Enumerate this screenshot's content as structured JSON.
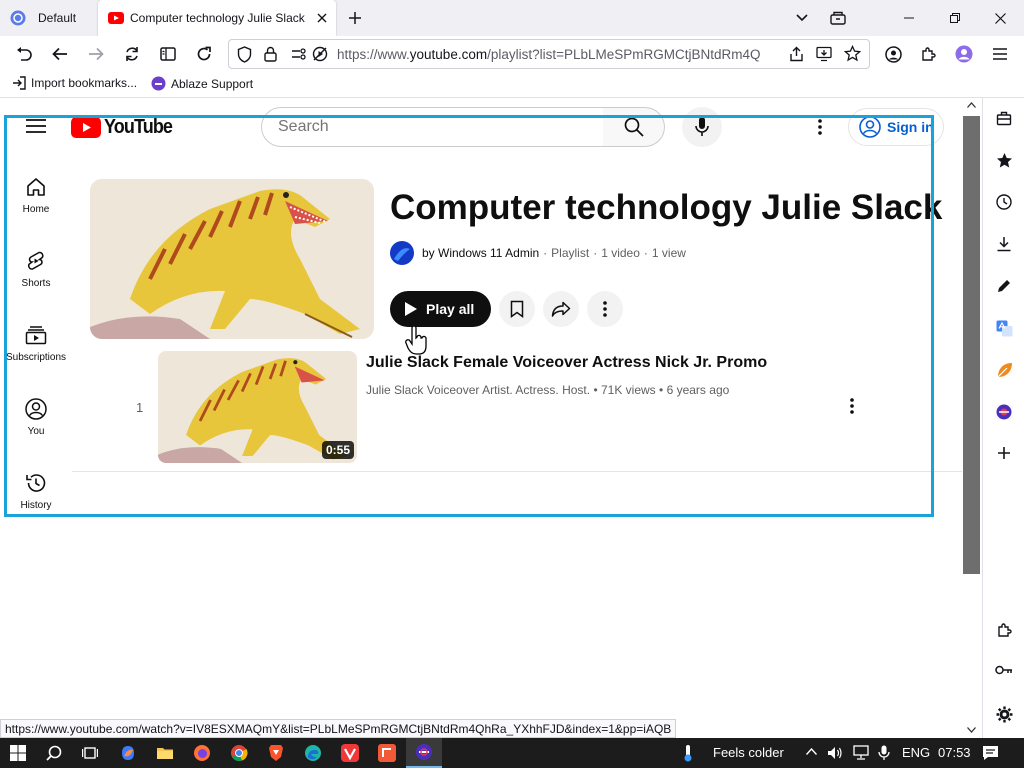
{
  "browser": {
    "tabs": [
      {
        "label": "Default",
        "active": false
      },
      {
        "label": "Computer technology Julie Slack",
        "active": true
      }
    ],
    "url_prefix": "https://www.",
    "url_domain": "youtube.com",
    "url_rest": "/playlist?list=PLbLMeSPmRGMCtjBNtdRm4Q",
    "bookmarks": [
      {
        "label": "Import bookmarks...",
        "icon": "import-icon"
      },
      {
        "label": "Ablaze Support",
        "icon": "ablaze-icon"
      }
    ],
    "status_url": "https://www.youtube.com/watch?v=IV8ESXMAQmY&list=PLbLMeSPmRGMCtjBNtdRm4QhRa_YXhhFJD&index=1&pp=iAQB"
  },
  "youtube": {
    "logo_text": "YouTube",
    "search_placeholder": "Search",
    "signin_label": "Sign in",
    "sidebar": [
      {
        "label": "Home",
        "icon": "home-icon"
      },
      {
        "label": "Shorts",
        "icon": "shorts-icon"
      },
      {
        "label": "Subscriptions",
        "icon": "subscriptions-icon"
      },
      {
        "label": "You",
        "icon": "you-icon"
      },
      {
        "label": "History",
        "icon": "history-icon"
      }
    ],
    "playlist": {
      "title": "Computer technology Julie Slack",
      "owner": "by Windows 11 Admin",
      "type": "Playlist",
      "video_count": "1 video",
      "views": "1 view",
      "play_all_label": "Play all"
    },
    "videos": [
      {
        "index": "1",
        "title": "Julie Slack Female Voiceover Actress Nick Jr. Promo",
        "channel": "Julie Slack Voiceover Artist. Actress. Host.",
        "views": "71K views",
        "age": "6 years ago",
        "duration": "0:55"
      }
    ]
  },
  "taskbar": {
    "weather": "Feels colder",
    "lang": "ENG",
    "time": "07:53"
  },
  "colors": {
    "youtube_red": "#ff0000",
    "highlight": "#1aa3d9",
    "link_blue": "#065fd4"
  }
}
